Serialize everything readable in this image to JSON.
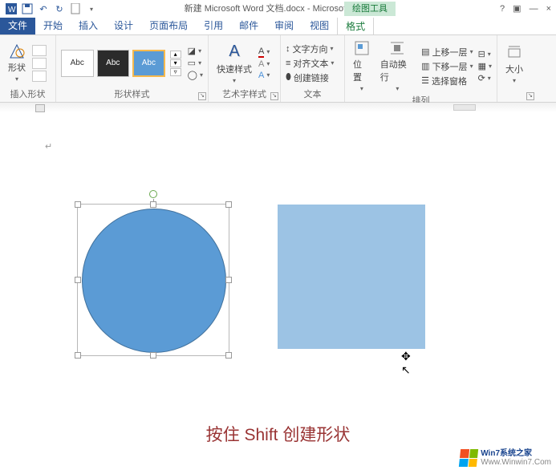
{
  "titlebar": {
    "doc_title": "新建 Microsoft Word 文档.docx - Microsoft Word",
    "contextual_label": "绘图工具",
    "help": "?",
    "ribbon_toggle": "▣",
    "minimize": "—",
    "close": "×"
  },
  "qat_icons": [
    "word-icon",
    "save-icon",
    "undo-icon",
    "redo-icon",
    "new-doc-icon",
    "qat-more"
  ],
  "tabs": {
    "file": "文件",
    "home": "开始",
    "insert": "插入",
    "design": "设计",
    "layout": "页面布局",
    "references": "引用",
    "mailings": "邮件",
    "review": "审阅",
    "view": "视图",
    "format": "格式"
  },
  "ribbon": {
    "insert_shape": {
      "label": "插入形状",
      "btn": "形状"
    },
    "shape_styles": {
      "label": "形状样式",
      "preset_text": "Abc",
      "fill": "▢",
      "outline": "▭",
      "effects": "◯"
    },
    "wordart": {
      "label": "艺术字样式",
      "btn": "快速样式",
      "a_large": "A",
      "a_fill": "A",
      "a_outline": "A",
      "a_effects": "A"
    },
    "text": {
      "label": "文本",
      "direction": "文字方向",
      "align": "对齐文本",
      "link": "创建链接"
    },
    "arrange": {
      "label": "排列",
      "position": "位置",
      "wrap": "自动换行",
      "bring_forward": "上移一层",
      "send_backward": "下移一层",
      "selection_pane": "选择窗格"
    },
    "size": {
      "label": "大小"
    }
  },
  "doc": {
    "caption": "按住 Shift 创建形状",
    "circle_color": "#5b9bd5",
    "square_color": "#9cc3e4",
    "para_mark": "↵"
  },
  "watermark": {
    "line1": "Win7系统之家",
    "line2": "Www.Winwin7.Com"
  }
}
